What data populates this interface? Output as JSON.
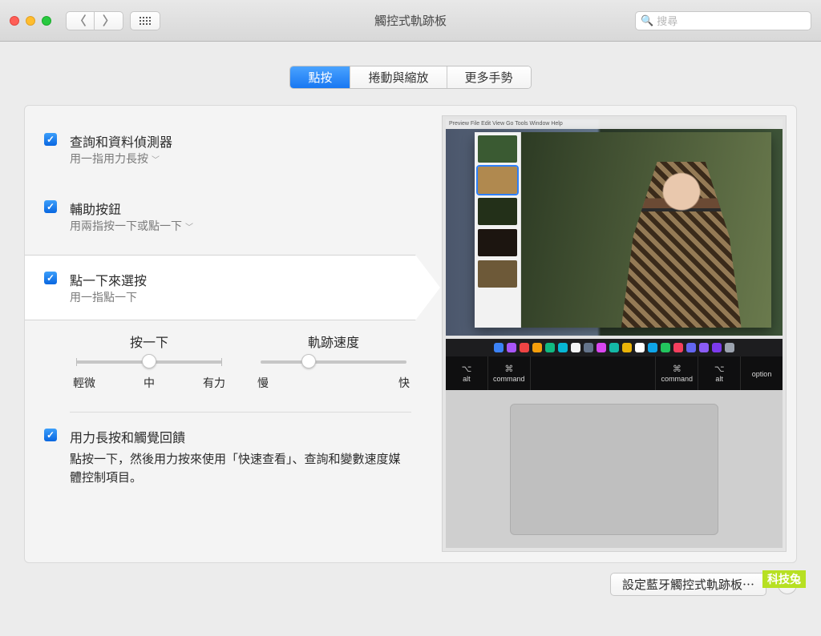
{
  "window": {
    "title": "觸控式軌跡板"
  },
  "search": {
    "placeholder": "搜尋"
  },
  "tabs": {
    "t1": "點按",
    "t2": "捲動與縮放",
    "t3": "更多手勢"
  },
  "options": [
    {
      "title": "查詢和資料偵測器",
      "sub": "用一指用力長按",
      "has_sub_menu": true
    },
    {
      "title": "輔助按鈕",
      "sub": "用兩指按一下或點一下",
      "has_sub_menu": true
    },
    {
      "title": "點一下來選按",
      "sub": "用一指點一下",
      "has_sub_menu": false
    }
  ],
  "sliders": {
    "click": {
      "label": "按一下",
      "scale": [
        "輕微",
        "中",
        "有力"
      ],
      "pos": 50
    },
    "speed": {
      "label": "軌跡速度",
      "scale_lo": "慢",
      "scale_hi": "快",
      "pos": 33
    }
  },
  "force": {
    "title": "用力長按和觸覺回饋",
    "desc": "點按一下，然後用力按來使用「快速查看」、查詢和變數速度媒體控制項目。"
  },
  "footer": {
    "bt": "設定藍牙觸控式軌跡板⋯",
    "help": "?"
  },
  "preview": {
    "menubar": " Preview  File  Edit  View  Go  Tools  Window  Help",
    "keys": [
      {
        "sym": "⌥",
        "label": "alt"
      },
      {
        "sym": "⌘",
        "label": "command"
      },
      {
        "sym": "",
        "label": ""
      },
      {
        "sym": "⌘",
        "label": "command"
      },
      {
        "sym": "⌥",
        "label": "alt"
      },
      {
        "sym": "",
        "label": "option"
      }
    ],
    "dock_colors": [
      "#3b82f6",
      "#a855f7",
      "#ef4444",
      "#f59e0b",
      "#10b981",
      "#06b6d4",
      "#f3f4f6",
      "#64748b",
      "#d946ef",
      "#14b8a6",
      "#eab308",
      "#ffffff",
      "#0ea5e9",
      "#22c55e",
      "#f43f5e",
      "#6366f1",
      "#8b5cf6",
      "#7c3aed",
      "#9ca3af"
    ],
    "thumbs": [
      "#3a5a32",
      "#b0894f",
      "#233019",
      "#1c1510",
      "#6d5938"
    ]
  },
  "watermark": "科技兔"
}
